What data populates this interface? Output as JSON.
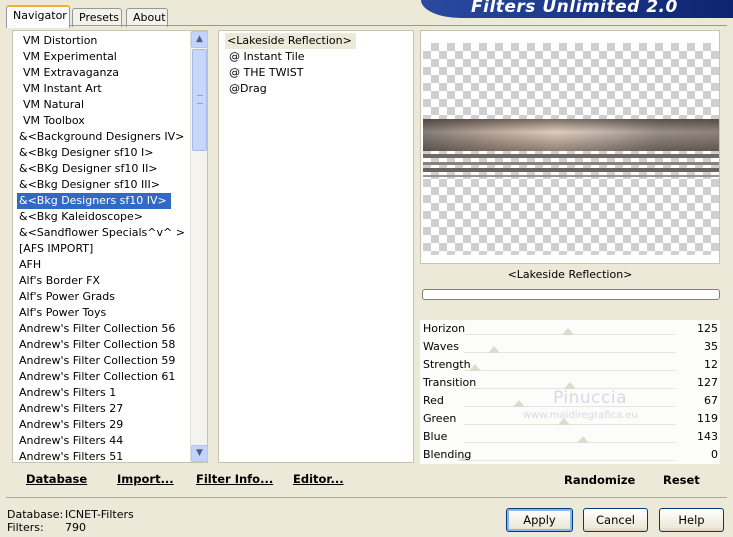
{
  "banner": {
    "title": "Filters Unlimited 2.0"
  },
  "tabs": [
    {
      "label": "Navigator",
      "active": true
    },
    {
      "label": "Presets",
      "active": false
    },
    {
      "label": "About",
      "active": false
    }
  ],
  "categories": [
    "VM Distortion",
    "VM Experimental",
    "VM Extravaganza",
    "VM Instant Art",
    "VM Natural",
    "VM Toolbox",
    "&<Background Designers IV>",
    "&<Bkg Designer sf10 I>",
    "&<BKg Designer sf10 II>",
    "&<Bkg Designer sf10 III>",
    "&<Bkg Designers sf10 IV>",
    "&<Bkg Kaleidoscope>",
    "&<Sandflower Specials^v^ >",
    "[AFS IMPORT]",
    "AFH",
    "Alf's Border FX",
    "Alf's Power Grads",
    "Alf's Power Toys",
    "Andrew's Filter Collection 56",
    "Andrew's Filter Collection 58",
    "Andrew's Filter Collection 59",
    "Andrew's Filter Collection 61",
    "Andrew's Filters 1",
    "Andrew's Filters 27",
    "Andrew's Filters 29",
    "Andrew's Filters 44",
    "Andrew's Filters 51"
  ],
  "selected_category_index": 10,
  "filters": [
    "<Lakeside Reflection>",
    "@ Instant Tile",
    "@ THE TWIST",
    "@Drag"
  ],
  "toolbar": {
    "database": "Database",
    "import": "Import...",
    "filter_info": "Filter Info...",
    "editor": "Editor..."
  },
  "preview": {
    "filter_name": "<Lakeside Reflection>"
  },
  "params": [
    {
      "name": "Horizon",
      "value": "125",
      "level": 0.49
    },
    {
      "name": "Waves",
      "value": "35",
      "level": 0.14
    },
    {
      "name": "Strength",
      "value": "12",
      "level": 0.05
    },
    {
      "name": "Transition",
      "value": "127",
      "level": 0.5
    },
    {
      "name": "Red",
      "value": "67",
      "level": 0.26
    },
    {
      "name": "Green",
      "value": "119",
      "level": 0.47
    },
    {
      "name": "Blue",
      "value": "143",
      "level": 0.56
    },
    {
      "name": "Blending",
      "value": "0",
      "level": 0.0
    }
  ],
  "watermark": {
    "name": "Pinuccia",
    "site": "www.maidiregrafica.eu"
  },
  "actions": {
    "randomize": "Randomize",
    "reset": "Reset"
  },
  "status": {
    "database_label": "Database:",
    "database_value": "ICNET-Filters",
    "filters_label": "Filters:",
    "filters_value": "790"
  },
  "dialog": {
    "apply": "Apply",
    "cancel": "Cancel",
    "help": "Help"
  }
}
